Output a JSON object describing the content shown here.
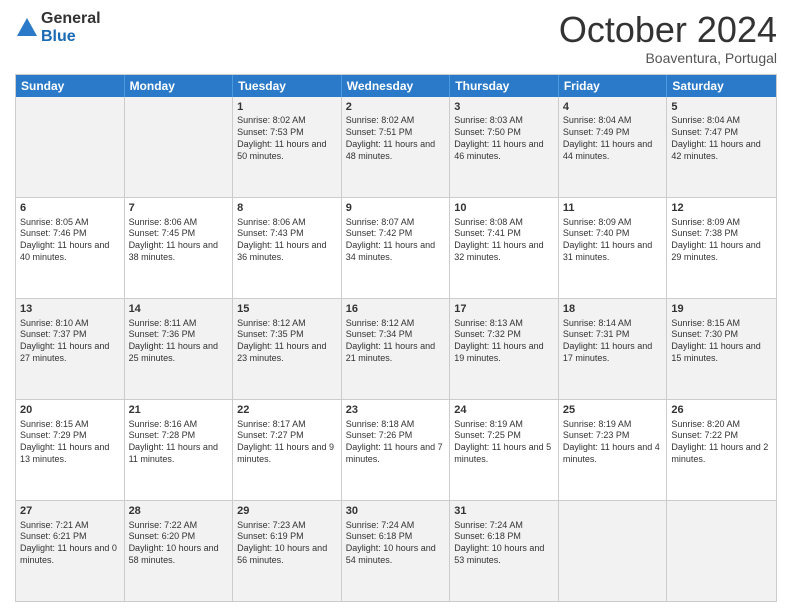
{
  "header": {
    "logo_line1": "General",
    "logo_line2": "Blue",
    "month": "October 2024",
    "location": "Boaventura, Portugal"
  },
  "days_of_week": [
    "Sunday",
    "Monday",
    "Tuesday",
    "Wednesday",
    "Thursday",
    "Friday",
    "Saturday"
  ],
  "rows": [
    [
      {
        "day": "",
        "lines": []
      },
      {
        "day": "",
        "lines": []
      },
      {
        "day": "1",
        "lines": [
          "Sunrise: 8:02 AM",
          "Sunset: 7:53 PM",
          "Daylight: 11 hours and 50 minutes."
        ]
      },
      {
        "day": "2",
        "lines": [
          "Sunrise: 8:02 AM",
          "Sunset: 7:51 PM",
          "Daylight: 11 hours and 48 minutes."
        ]
      },
      {
        "day": "3",
        "lines": [
          "Sunrise: 8:03 AM",
          "Sunset: 7:50 PM",
          "Daylight: 11 hours and 46 minutes."
        ]
      },
      {
        "day": "4",
        "lines": [
          "Sunrise: 8:04 AM",
          "Sunset: 7:49 PM",
          "Daylight: 11 hours and 44 minutes."
        ]
      },
      {
        "day": "5",
        "lines": [
          "Sunrise: 8:04 AM",
          "Sunset: 7:47 PM",
          "Daylight: 11 hours and 42 minutes."
        ]
      }
    ],
    [
      {
        "day": "6",
        "lines": [
          "Sunrise: 8:05 AM",
          "Sunset: 7:46 PM",
          "Daylight: 11 hours and 40 minutes."
        ]
      },
      {
        "day": "7",
        "lines": [
          "Sunrise: 8:06 AM",
          "Sunset: 7:45 PM",
          "Daylight: 11 hours and 38 minutes."
        ]
      },
      {
        "day": "8",
        "lines": [
          "Sunrise: 8:06 AM",
          "Sunset: 7:43 PM",
          "Daylight: 11 hours and 36 minutes."
        ]
      },
      {
        "day": "9",
        "lines": [
          "Sunrise: 8:07 AM",
          "Sunset: 7:42 PM",
          "Daylight: 11 hours and 34 minutes."
        ]
      },
      {
        "day": "10",
        "lines": [
          "Sunrise: 8:08 AM",
          "Sunset: 7:41 PM",
          "Daylight: 11 hours and 32 minutes."
        ]
      },
      {
        "day": "11",
        "lines": [
          "Sunrise: 8:09 AM",
          "Sunset: 7:40 PM",
          "Daylight: 11 hours and 31 minutes."
        ]
      },
      {
        "day": "12",
        "lines": [
          "Sunrise: 8:09 AM",
          "Sunset: 7:38 PM",
          "Daylight: 11 hours and 29 minutes."
        ]
      }
    ],
    [
      {
        "day": "13",
        "lines": [
          "Sunrise: 8:10 AM",
          "Sunset: 7:37 PM",
          "Daylight: 11 hours and 27 minutes."
        ]
      },
      {
        "day": "14",
        "lines": [
          "Sunrise: 8:11 AM",
          "Sunset: 7:36 PM",
          "Daylight: 11 hours and 25 minutes."
        ]
      },
      {
        "day": "15",
        "lines": [
          "Sunrise: 8:12 AM",
          "Sunset: 7:35 PM",
          "Daylight: 11 hours and 23 minutes."
        ]
      },
      {
        "day": "16",
        "lines": [
          "Sunrise: 8:12 AM",
          "Sunset: 7:34 PM",
          "Daylight: 11 hours and 21 minutes."
        ]
      },
      {
        "day": "17",
        "lines": [
          "Sunrise: 8:13 AM",
          "Sunset: 7:32 PM",
          "Daylight: 11 hours and 19 minutes."
        ]
      },
      {
        "day": "18",
        "lines": [
          "Sunrise: 8:14 AM",
          "Sunset: 7:31 PM",
          "Daylight: 11 hours and 17 minutes."
        ]
      },
      {
        "day": "19",
        "lines": [
          "Sunrise: 8:15 AM",
          "Sunset: 7:30 PM",
          "Daylight: 11 hours and 15 minutes."
        ]
      }
    ],
    [
      {
        "day": "20",
        "lines": [
          "Sunrise: 8:15 AM",
          "Sunset: 7:29 PM",
          "Daylight: 11 hours and 13 minutes."
        ]
      },
      {
        "day": "21",
        "lines": [
          "Sunrise: 8:16 AM",
          "Sunset: 7:28 PM",
          "Daylight: 11 hours and 11 minutes."
        ]
      },
      {
        "day": "22",
        "lines": [
          "Sunrise: 8:17 AM",
          "Sunset: 7:27 PM",
          "Daylight: 11 hours and 9 minutes."
        ]
      },
      {
        "day": "23",
        "lines": [
          "Sunrise: 8:18 AM",
          "Sunset: 7:26 PM",
          "Daylight: 11 hours and 7 minutes."
        ]
      },
      {
        "day": "24",
        "lines": [
          "Sunrise: 8:19 AM",
          "Sunset: 7:25 PM",
          "Daylight: 11 hours and 5 minutes."
        ]
      },
      {
        "day": "25",
        "lines": [
          "Sunrise: 8:19 AM",
          "Sunset: 7:23 PM",
          "Daylight: 11 hours and 4 minutes."
        ]
      },
      {
        "day": "26",
        "lines": [
          "Sunrise: 8:20 AM",
          "Sunset: 7:22 PM",
          "Daylight: 11 hours and 2 minutes."
        ]
      }
    ],
    [
      {
        "day": "27",
        "lines": [
          "Sunrise: 7:21 AM",
          "Sunset: 6:21 PM",
          "Daylight: 11 hours and 0 minutes."
        ]
      },
      {
        "day": "28",
        "lines": [
          "Sunrise: 7:22 AM",
          "Sunset: 6:20 PM",
          "Daylight: 10 hours and 58 minutes."
        ]
      },
      {
        "day": "29",
        "lines": [
          "Sunrise: 7:23 AM",
          "Sunset: 6:19 PM",
          "Daylight: 10 hours and 56 minutes."
        ]
      },
      {
        "day": "30",
        "lines": [
          "Sunrise: 7:24 AM",
          "Sunset: 6:18 PM",
          "Daylight: 10 hours and 54 minutes."
        ]
      },
      {
        "day": "31",
        "lines": [
          "Sunrise: 7:24 AM",
          "Sunset: 6:18 PM",
          "Daylight: 10 hours and 53 minutes."
        ]
      },
      {
        "day": "",
        "lines": []
      },
      {
        "day": "",
        "lines": []
      }
    ]
  ],
  "alt_rows": [
    0,
    2,
    4
  ]
}
